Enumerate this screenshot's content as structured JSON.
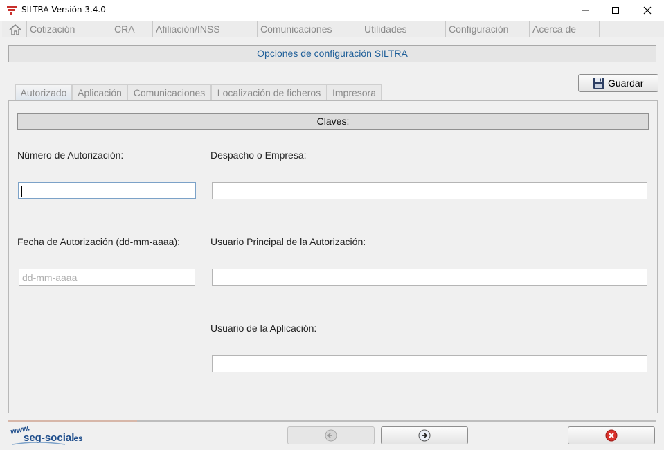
{
  "window": {
    "title": "SILTRA Versión 3.4.0",
    "controls": [
      "minimize-icon",
      "maximize-icon",
      "close-icon"
    ]
  },
  "menu": {
    "home_icon": "home-icon",
    "items": [
      {
        "label": "Cotización"
      },
      {
        "label": "CRA"
      },
      {
        "label": "Afiliación/INSS"
      },
      {
        "label": "Comunicaciones"
      },
      {
        "label": "Utilidades"
      },
      {
        "label": "Configuración"
      },
      {
        "label": "Acerca de"
      }
    ]
  },
  "header": {
    "title": "Opciones de configuración SILTRA"
  },
  "toolbar": {
    "save_label": "Guardar",
    "save_icon": "floppy-disk-icon"
  },
  "tabs": [
    {
      "label": "Autorizado",
      "active": true
    },
    {
      "label": "Aplicación",
      "active": false
    },
    {
      "label": "Comunicaciones",
      "active": false
    },
    {
      "label": "Localización de ficheros",
      "active": false
    },
    {
      "label": "Impresora",
      "active": false
    }
  ],
  "section": {
    "title": "Claves:"
  },
  "form": {
    "numero_autorizacion": {
      "label": "Número de Autorización:",
      "value": "",
      "placeholder": ""
    },
    "despacho_empresa": {
      "label": "Despacho o Empresa:",
      "value": "",
      "placeholder": ""
    },
    "fecha_autorizacion": {
      "label": "Fecha de Autorización (dd-mm-aaaa):",
      "value": "",
      "placeholder": "dd-mm-aaaa"
    },
    "usuario_principal": {
      "label": "Usuario Principal de la Autorización:",
      "value": "",
      "placeholder": ""
    },
    "usuario_aplicacion": {
      "label": "Usuario de la Aplicación:",
      "value": "",
      "placeholder": ""
    }
  },
  "footer": {
    "logo_text": "www.seg-social.es",
    "prev_icon": "arrow-left-circle-icon",
    "next_icon": "arrow-right-circle-icon",
    "close_icon": "red-x-circle-icon"
  },
  "colors": {
    "header_text": "#1f5f99",
    "logo_blue": "#1f4e8c",
    "close_red": "#d9322c"
  }
}
